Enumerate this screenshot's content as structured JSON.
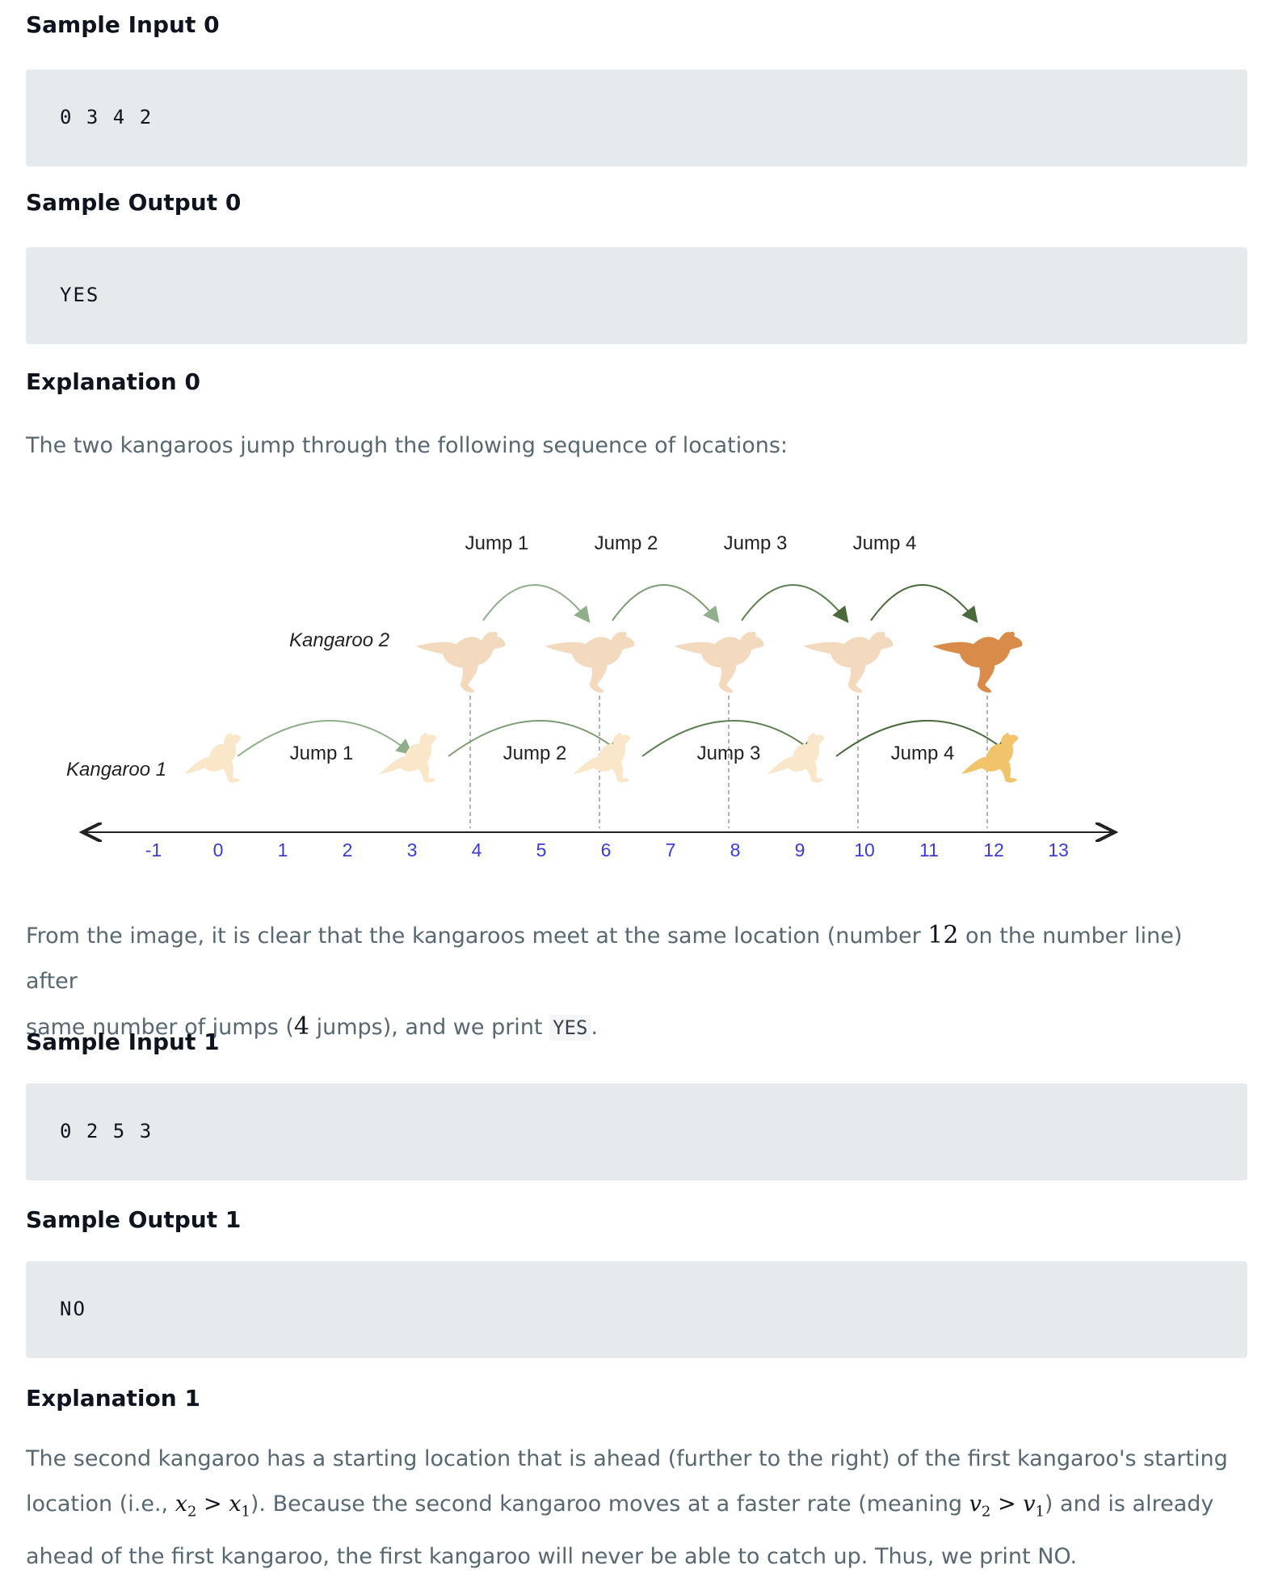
{
  "sample_input_0": {
    "heading": "Sample Input 0",
    "code": "0 3 4 2"
  },
  "sample_output_0": {
    "heading": "Sample Output 0",
    "code": "YES"
  },
  "explanation_0": {
    "heading": "Explanation 0",
    "intro": "The two kangaroos jump through the following sequence of locations:",
    "p1_a": "From the image, it is clear that the kangaroos meet at the same location (number ",
    "p1_num": "12",
    "p1_b": " on the number line) after",
    "p2_a": "same number of jumps (",
    "p2_num": "4",
    "p2_b": " jumps), and we print ",
    "p2_code": "YES",
    "p2_c": "."
  },
  "figure": {
    "kangaroo1_label": "Kangaroo 1",
    "kangaroo2_label": "Kangaroo 2",
    "top_jump_labels": [
      "Jump 1",
      "Jump 2",
      "Jump 3",
      "Jump 4"
    ],
    "bottom_jump_labels": [
      "Jump 1",
      "Jump 2",
      "Jump 3",
      "Jump 4"
    ],
    "ticks": [
      "-1",
      "0",
      "1",
      "2",
      "3",
      "4",
      "5",
      "6",
      "7",
      "8",
      "9",
      "10",
      "11",
      "12",
      "13"
    ],
    "colors": {
      "tick_text": "#3b3bd9",
      "kangaroo_light": "#f3d9bd",
      "kangaroo_final_top": "#d98c4a",
      "kangaroo_final_bottom": "#f1c36a",
      "arrow_light": "#8fae8a",
      "arrow_dark": "#4a6a3c"
    }
  },
  "sample_input_1": {
    "heading": "Sample Input 1",
    "code": "0 2 5 3"
  },
  "sample_output_1": {
    "heading": "Sample Output 1",
    "code": "NO"
  },
  "explanation_1": {
    "heading": "Explanation 1",
    "l1": "The second kangaroo has a starting location that is ahead (further to the right) of the first kangaroo's starting",
    "l2_a": "location (i.e., ",
    "l2_b": "). Because the second kangaroo moves at a faster rate (meaning ",
    "l2_c": ") and is already",
    "l3": "ahead of the first kangaroo, the first kangaroo will never be able to catch up. Thus, we print NO.",
    "math1": {
      "lhs": "x",
      "lhs_sub": "2",
      "op": ">",
      "rhs": "x",
      "rhs_sub": "1"
    },
    "math2": {
      "lhs": "v",
      "lhs_sub": "2",
      "op": ">",
      "rhs": "v",
      "rhs_sub": "1"
    }
  }
}
